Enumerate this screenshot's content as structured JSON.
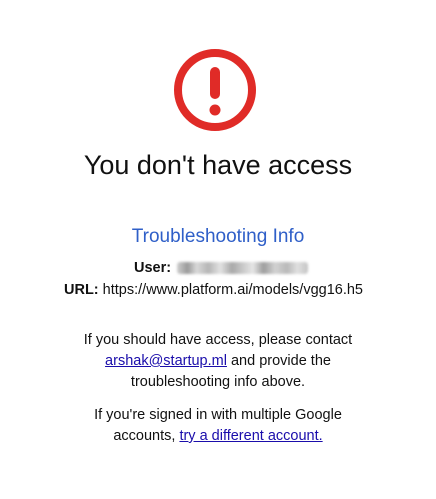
{
  "colors": {
    "alert_red": "#e02b27",
    "title_blue": "#2f5fc8",
    "link_blue": "#1a0dab"
  },
  "icon": {
    "name": "exclamation-circle-icon"
  },
  "heading": "You don't have access",
  "troubleshooting": {
    "title": "Troubleshooting Info",
    "user_label": "User:",
    "url_label": "URL:",
    "url_value": "https://www.platform.ai/models/vgg16.h5"
  },
  "message1": {
    "line1": "If you should have access, please contact",
    "email": "arshak@startup.ml",
    "line2_suffix": " and provide the",
    "line3": "troubleshooting info above."
  },
  "message2": {
    "line1": "If you're signed in with multiple Google",
    "line2_prefix": "accounts, ",
    "link": "try a different account."
  }
}
